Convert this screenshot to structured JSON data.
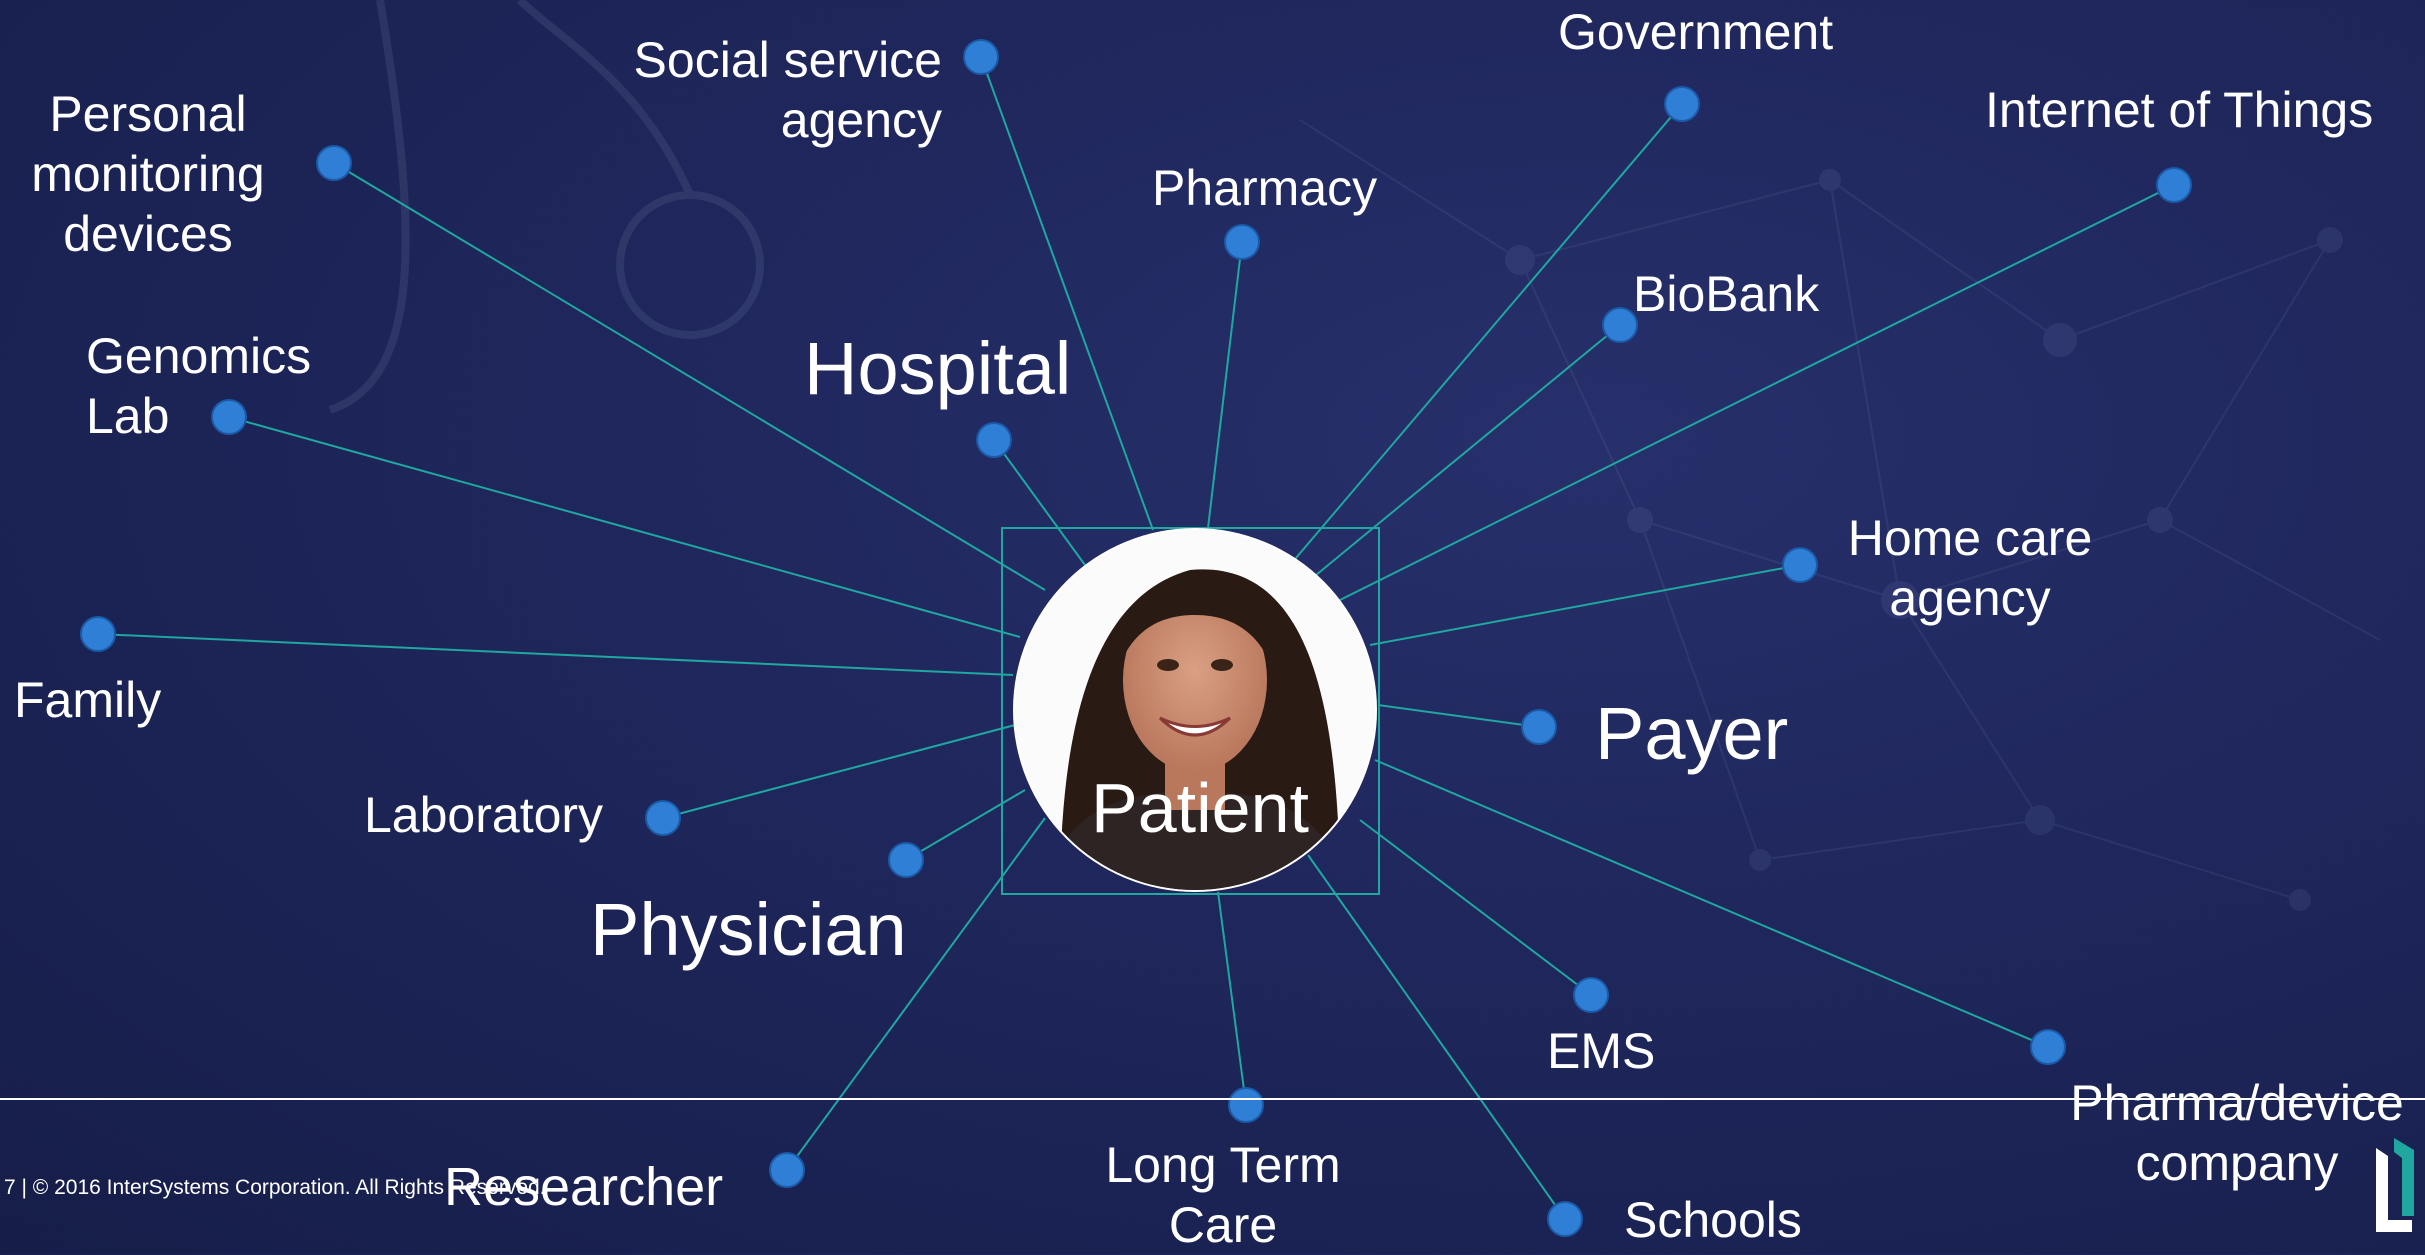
{
  "center": {
    "label": "Patient",
    "portrait_icon": "woman-portrait"
  },
  "colors": {
    "background": "#1f275d",
    "node": "#2f7fd6",
    "edge": "#1fa7a0",
    "text": "#ffffff",
    "divider": "#ffffff"
  },
  "nodes": [
    {
      "id": "social-service",
      "label": "Social service\nagency"
    },
    {
      "id": "government",
      "label": "Government"
    },
    {
      "id": "personal-monitoring",
      "label": "Personal\nmonitoring\ndevices"
    },
    {
      "id": "internet-of-things",
      "label": "Internet of Things"
    },
    {
      "id": "pharmacy",
      "label": "Pharmacy"
    },
    {
      "id": "biobank",
      "label": "BioBank"
    },
    {
      "id": "genomics-lab",
      "label": "Genomics\nLab"
    },
    {
      "id": "hospital",
      "label": "Hospital"
    },
    {
      "id": "home-care",
      "label": "Home care\nagency"
    },
    {
      "id": "family",
      "label": "Family"
    },
    {
      "id": "payer",
      "label": "Payer"
    },
    {
      "id": "laboratory",
      "label": "Laboratory"
    },
    {
      "id": "physician",
      "label": "Physician"
    },
    {
      "id": "ems",
      "label": "EMS"
    },
    {
      "id": "pharma-device",
      "label": "Pharma/device\ncompany"
    },
    {
      "id": "long-term-care",
      "label": "Long Term\nCare"
    },
    {
      "id": "researcher",
      "label": "Researcher"
    },
    {
      "id": "schools",
      "label": "Schools"
    }
  ],
  "footer": {
    "text": "7  |  © 2016 InterSystems Corporation. All Rights Reserved."
  },
  "logo": {
    "icon": "intersystems-logo"
  }
}
